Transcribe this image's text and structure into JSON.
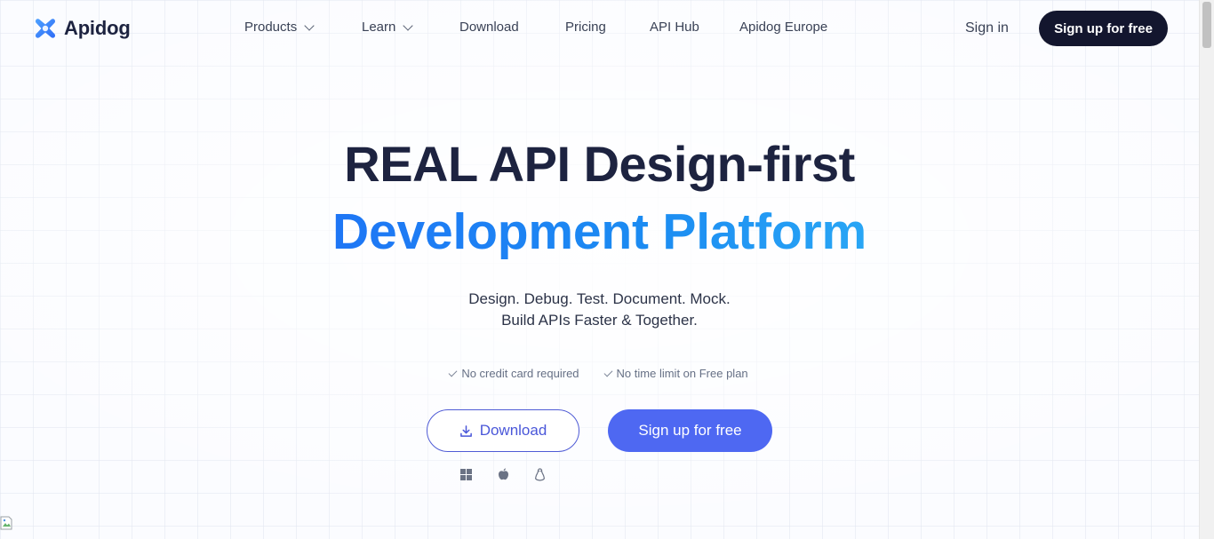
{
  "header": {
    "logo_text": "Apidog",
    "nav": [
      {
        "label": "Products",
        "has_dropdown": true
      },
      {
        "label": "Learn",
        "has_dropdown": true
      },
      {
        "label": "Download",
        "has_dropdown": false
      },
      {
        "label": "Pricing",
        "has_dropdown": false
      },
      {
        "label": "API Hub",
        "has_dropdown": false
      },
      {
        "label": "Apidog Europe",
        "has_dropdown": false
      }
    ],
    "sign_in": "Sign in",
    "signup": "Sign up for free"
  },
  "hero": {
    "title_line1": "REAL API Design-first",
    "title_line2": "Development Platform",
    "subtitle_line1": "Design. Debug. Test. Document. Mock.",
    "subtitle_line2": "Build APIs Faster & Together.",
    "checks": [
      "No credit card required",
      "No time limit on Free plan"
    ],
    "download_button": "Download",
    "signup_button": "Sign up for free",
    "platforms": [
      "windows-icon",
      "apple-icon",
      "linux-icon"
    ]
  },
  "colors": {
    "brand_dark": "#13162e",
    "title_dark": "#1d2340",
    "accent_blue": "#1e76f5",
    "button_primary": "#4e68f2",
    "button_outline": "#4f5bd5"
  }
}
